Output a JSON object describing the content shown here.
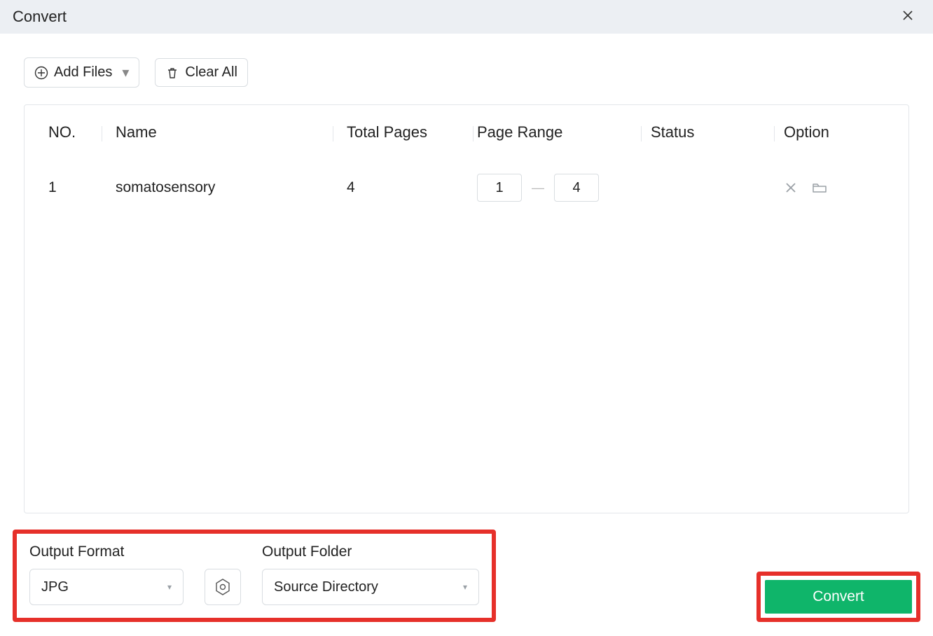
{
  "window": {
    "title": "Convert"
  },
  "toolbar": {
    "add_files_label": "Add Files",
    "clear_all_label": "Clear All"
  },
  "table": {
    "headers": {
      "no": "NO.",
      "name": "Name",
      "pages": "Total Pages",
      "range": "Page Range",
      "status": "Status",
      "option": "Option"
    },
    "rows": [
      {
        "no": "1",
        "name": "somatosensory",
        "total_pages": "4",
        "range_from": "1",
        "range_to": "4",
        "status": ""
      }
    ]
  },
  "output": {
    "format_label": "Output Format",
    "format_value": "JPG",
    "folder_label": "Output Folder",
    "folder_value": "Source Directory"
  },
  "actions": {
    "convert_label": "Convert"
  },
  "range_separator": "—"
}
